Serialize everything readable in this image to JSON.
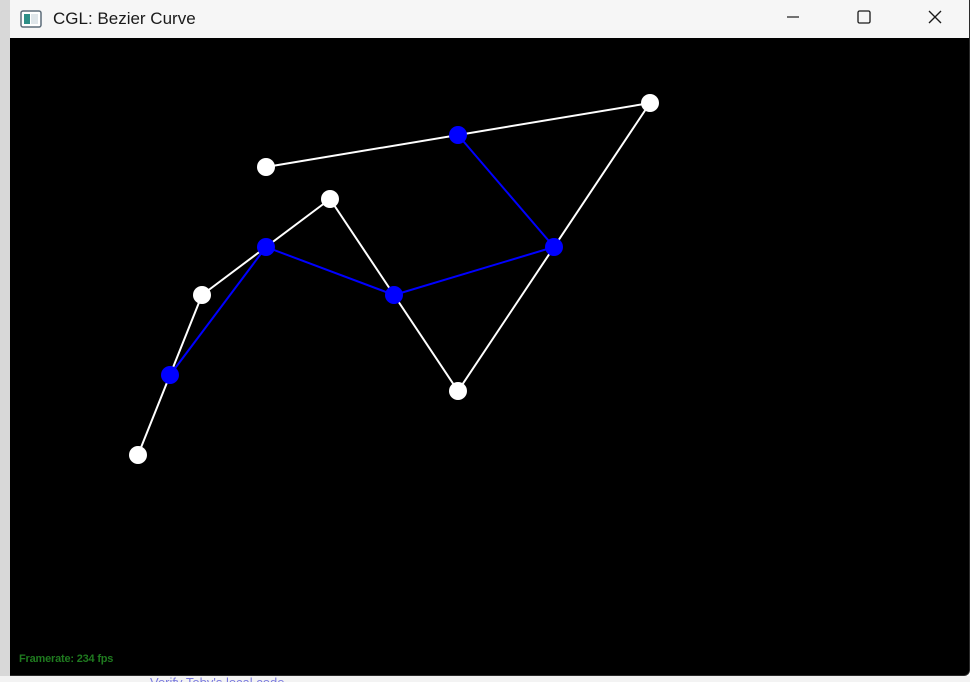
{
  "window": {
    "title": "CGL: Bezier Curve",
    "icon": "app-window-icon",
    "buttons": {
      "minimize": "minimize-icon",
      "maximize": "maximize-icon",
      "close": "close-icon"
    }
  },
  "status": {
    "framerate_text": "Framerate: 234 fps",
    "color": "#1f7a1f"
  },
  "colors": {
    "background": "#000000",
    "control_polygon": "#ffffff",
    "intermediate": "#0000ff"
  },
  "background_text": "Verify Toby's local code"
}
